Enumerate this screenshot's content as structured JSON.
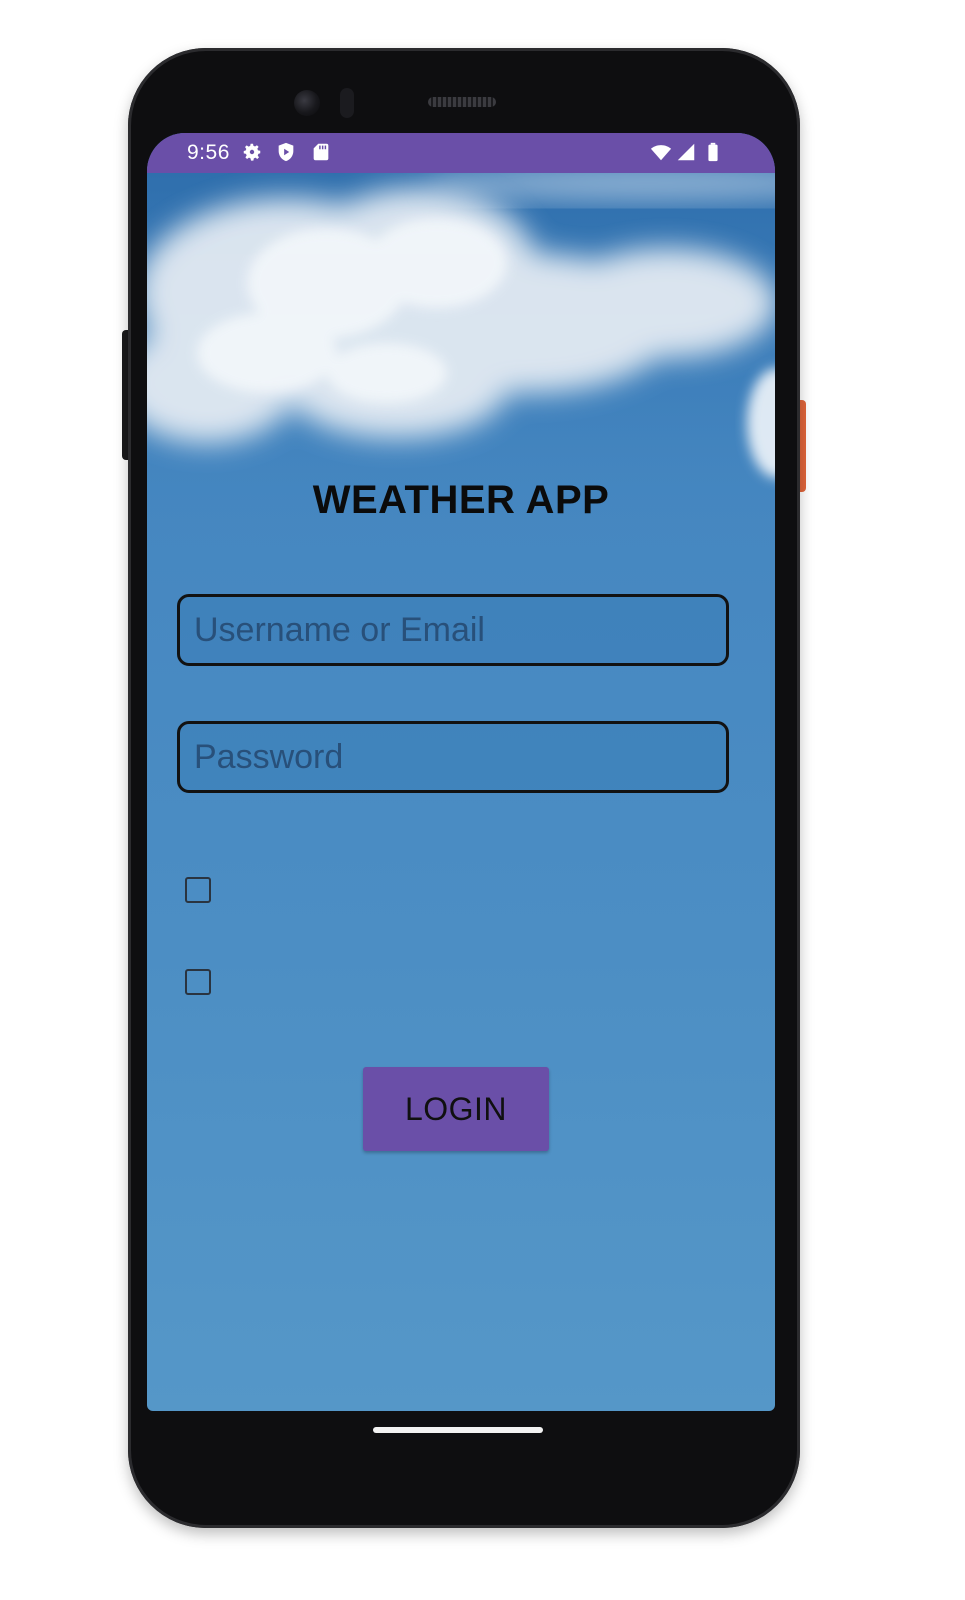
{
  "status_bar": {
    "time": "9:56",
    "left_icons": [
      "gear-icon",
      "shield-icon",
      "sd-card-icon"
    ],
    "right_icons": [
      "wifi-icon",
      "signal-icon",
      "battery-icon"
    ],
    "color": "#6a4fa8"
  },
  "app": {
    "title": "WEATHER APP"
  },
  "form": {
    "username": {
      "value": "",
      "placeholder": "Username or Email"
    },
    "password": {
      "value": "",
      "placeholder": "Password"
    },
    "checkboxes": [
      {
        "checked": false,
        "label": ""
      },
      {
        "checked": false,
        "label": ""
      }
    ],
    "login_label": "LOGIN",
    "button_color": "#6a4fa8"
  },
  "colors": {
    "sky_top": "#3b7bb9",
    "sky_bottom": "#5597c8"
  }
}
